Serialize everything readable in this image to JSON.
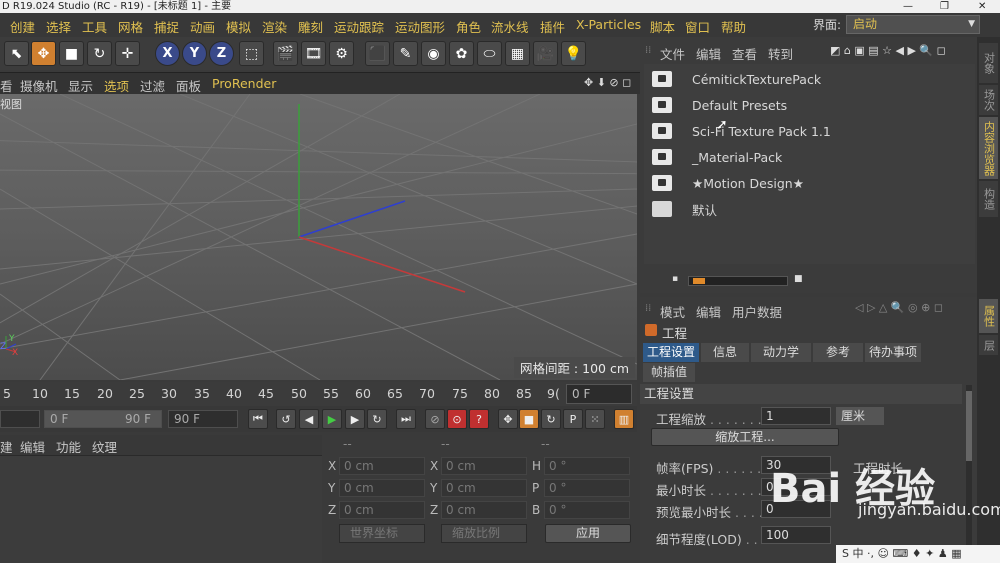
{
  "window": {
    "title": "D R19.024 Studio (RC - R19) - [未标题 1] - 主要",
    "controls": [
      "—",
      "❐",
      "✕"
    ]
  },
  "menubar": {
    "items": [
      "创建",
      "选择",
      "工具",
      "网格",
      "捕捉",
      "动画",
      "模拟",
      "渲染",
      "雕刻",
      "运动跟踪",
      "运动图形",
      "角色",
      "流水线",
      "插件",
      "X-Particles",
      "脚本",
      "窗口",
      "帮助"
    ],
    "layout_label": "界面:",
    "layout_value": "启动"
  },
  "toolbar": {
    "axis_buttons": [
      "X",
      "Y",
      "Z"
    ]
  },
  "viewport_menu": {
    "items": [
      "看",
      "摄像机",
      "显示",
      "选项",
      "过滤",
      "面板",
      "ProRender"
    ]
  },
  "viewport": {
    "label": "视图",
    "grid_readout": "网格间距 : 100 cm",
    "axes": {
      "y": "Y",
      "x": "X",
      "z": "Z"
    }
  },
  "timeline": {
    "ticks": [
      "5",
      "10",
      "15",
      "20",
      "25",
      "30",
      "35",
      "40",
      "45",
      "50",
      "55",
      "60",
      "65",
      "70",
      "75",
      "80",
      "85",
      "9("
    ],
    "current_frame": "0 F"
  },
  "transport": {
    "range_start": "0 F",
    "range_end": "90 F",
    "end_frame": "90 F"
  },
  "material_menu": {
    "items": [
      "建",
      "编辑",
      "功能",
      "纹理"
    ]
  },
  "coordinates": {
    "headers": [
      "--",
      "--",
      "--"
    ],
    "rows": [
      {
        "a": "X",
        "a_val": "0 cm",
        "b": "X",
        "b_val": "0 cm",
        "c": "H",
        "c_val": "0 °"
      },
      {
        "a": "Y",
        "a_val": "0 cm",
        "b": "Y",
        "b_val": "0 cm",
        "c": "P",
        "c_val": "0 °"
      },
      {
        "a": "Z",
        "a_val": "0 cm",
        "b": "Z",
        "b_val": "0 cm",
        "c": "B",
        "c_val": "0 °"
      }
    ],
    "world_select": "世界坐标",
    "scale_select": "缩放比例",
    "apply": "应用"
  },
  "content_browser": {
    "menu": [
      "文件",
      "编辑",
      "查看",
      "转到"
    ],
    "items": [
      {
        "label": "CémitickTexturePack",
        "icon": "preset-icon"
      },
      {
        "label": "Default Presets",
        "icon": "preset-icon"
      },
      {
        "label": "Sci-Fi Texture Pack 1.1",
        "icon": "preset-icon"
      },
      {
        "label": "_Material-Pack",
        "icon": "preset-icon"
      },
      {
        "label": "★Motion Design★",
        "icon": "preset-icon"
      },
      {
        "label": "默认",
        "icon": "folder-icon"
      }
    ]
  },
  "attributes": {
    "menu": [
      "模式",
      "编辑",
      "用户数据"
    ],
    "object_title": "工程",
    "tabs": [
      "工程设置",
      "信息",
      "动力学",
      "参考",
      "待办事项",
      "帧插值"
    ],
    "active_tab": "工程设置",
    "section": "工程设置",
    "rows": [
      {
        "label": "工程缩放",
        "dots": " . . . . . . . . .",
        "value": "1",
        "unit": "厘米"
      },
      {
        "label": "帧率(FPS)",
        "dots": " . . . . . . .",
        "value": "30",
        "right_label": "工程时长"
      },
      {
        "label": "最小时长",
        "dots": " . . . . . . . . .",
        "value": "0"
      },
      {
        "label": "预览最小时长",
        "dots": " . . . . .",
        "value": "0"
      },
      {
        "label": "细节程度(LOD)",
        "dots": " . . . .",
        "value": "100"
      }
    ],
    "scale_button": "缩放工程..."
  },
  "right_tabs": [
    "对象",
    "场次",
    "内容浏览器",
    "构造",
    "属性",
    "层"
  ],
  "watermark": {
    "logo": "Bai 经验",
    "url": "jingyan.baidu.com"
  },
  "taskbar": {
    "text": "S 中 ·, ☺ ⌨ ♦ ✦ ♟ ▦"
  }
}
